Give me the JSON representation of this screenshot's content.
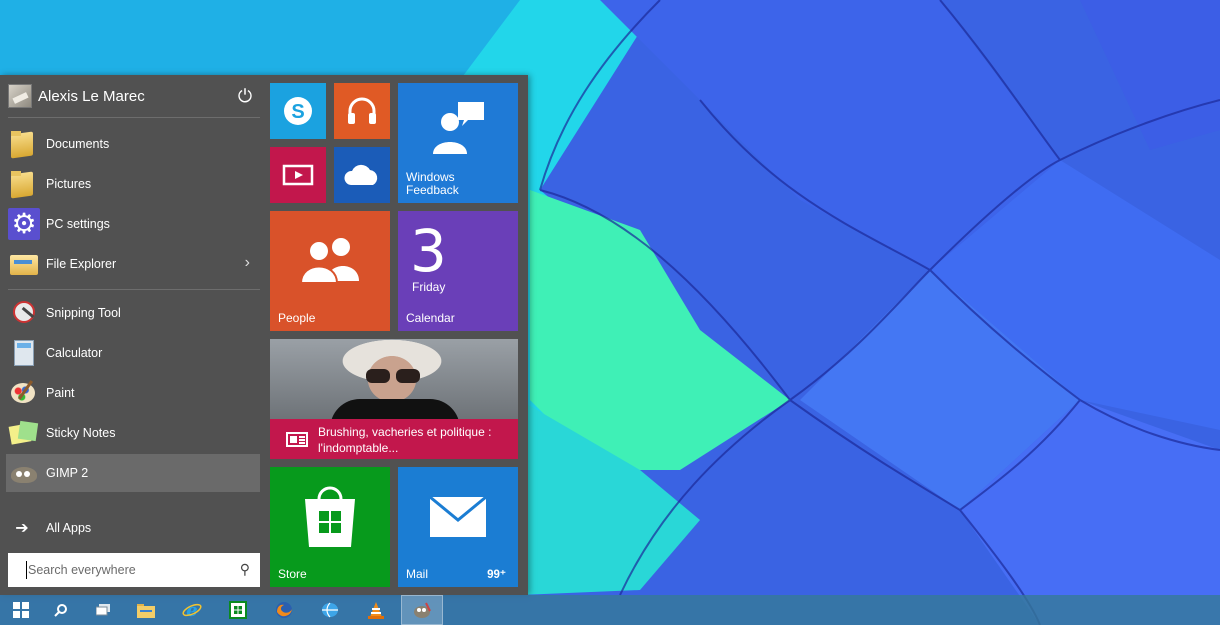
{
  "user": {
    "name": "Alexis Le Marec"
  },
  "places": [
    {
      "label": "Documents",
      "icon": "folder-icon"
    },
    {
      "label": "Pictures",
      "icon": "folder-icon"
    },
    {
      "label": "PC settings",
      "icon": "gear-icon"
    },
    {
      "label": "File Explorer",
      "icon": "file-explorer-icon",
      "has_submenu": true
    }
  ],
  "apps": [
    {
      "label": "Snipping Tool",
      "icon": "snipping-tool-icon"
    },
    {
      "label": "Calculator",
      "icon": "calculator-icon"
    },
    {
      "label": "Paint",
      "icon": "paint-icon"
    },
    {
      "label": "Sticky Notes",
      "icon": "sticky-notes-icon"
    },
    {
      "label": "GIMP 2",
      "icon": "gimp-icon",
      "selected": true
    }
  ],
  "all_apps_label": "All Apps",
  "search": {
    "placeholder": "Search everywhere"
  },
  "tiles": {
    "feedback": "Windows Feedback",
    "people": "People",
    "calendar": {
      "day": "3",
      "weekday": "Friday",
      "label": "Calendar"
    },
    "news": {
      "headline": "Brushing, vacheries et politique : l'indomptable..."
    },
    "store": "Store",
    "mail": {
      "label": "Mail",
      "count": "99⁺"
    }
  },
  "colors": {
    "skype": "#1ba2e0",
    "music": "#e05a25",
    "video": "#c2174c",
    "onedrive": "#1b5cb8",
    "feedback": "#1f7ad6",
    "people": "#d9522a",
    "calendar": "#6a3fb8",
    "news": "#c2174c",
    "store": "#079a1c",
    "mail": "#1b7dd3",
    "menu_bg": "#515151"
  },
  "taskbar": {
    "buttons": [
      {
        "icon": "windows-logo-icon"
      },
      {
        "icon": "search-icon"
      },
      {
        "icon": "task-view-icon"
      },
      {
        "icon": "file-explorer-icon"
      },
      {
        "icon": "internet-explorer-icon"
      },
      {
        "icon": "store-icon"
      },
      {
        "icon": "firefox-icon"
      },
      {
        "icon": "network-icon"
      },
      {
        "icon": "vlc-icon"
      },
      {
        "icon": "gimp-icon",
        "active": true
      }
    ]
  }
}
